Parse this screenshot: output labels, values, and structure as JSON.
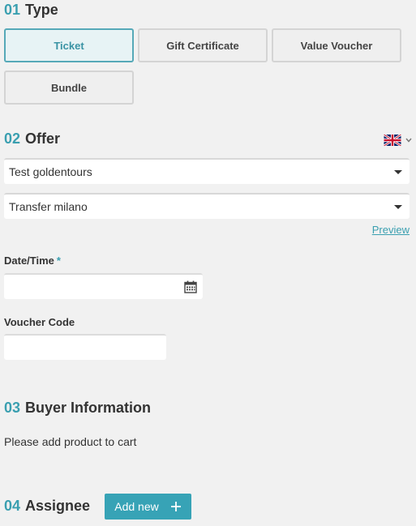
{
  "sections": {
    "type": {
      "num": "01",
      "title": "Type"
    },
    "offer": {
      "num": "02",
      "title": "Offer"
    },
    "buyer": {
      "num": "03",
      "title": "Buyer Information"
    },
    "assignee": {
      "num": "04",
      "title": "Assignee"
    }
  },
  "type_options": {
    "ticket": "Ticket",
    "gift_certificate": "Gift Certificate",
    "value_voucher": "Value Voucher",
    "bundle": "Bundle",
    "selected": "Ticket"
  },
  "offer": {
    "language_icon": "uk-flag-icon",
    "select_1": "Test goldentours",
    "select_2": "Transfer milano",
    "preview_link": "Preview"
  },
  "fields": {
    "datetime_label": "Date/Time",
    "datetime_required": "*",
    "datetime_value": "",
    "calendar_icon": "calendar-icon",
    "voucher_label": "Voucher Code",
    "voucher_value": ""
  },
  "buyer": {
    "message": "Please add product to cart"
  },
  "assignee": {
    "add_new_label": "Add new",
    "add_icon": "plus-icon"
  },
  "colors": {
    "accent": "#3a9fb0",
    "button": "#37a3b6",
    "background": "#f1f1f1"
  }
}
